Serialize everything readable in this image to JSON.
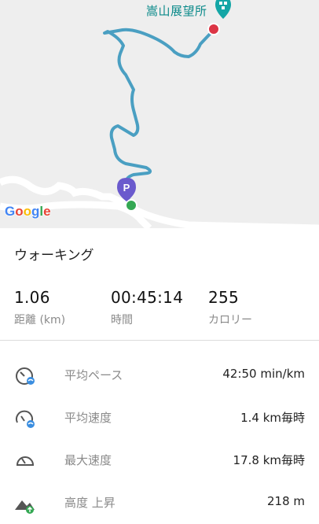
{
  "map": {
    "poi_label": "嵩山展望所",
    "poi_icon": "poi-marker-icon",
    "parking_icon": "parking-marker-icon",
    "parking_letter": "P",
    "google_logo": [
      "G",
      "o",
      "o",
      "g",
      "l",
      "e"
    ],
    "google_colors": [
      "#4285F4",
      "#EA4335",
      "#FBBC05",
      "#4285F4",
      "#34A853",
      "#EA4335"
    ],
    "route_color": "#4a9fc2",
    "start_color": "#34a853",
    "end_color": "#dc3545"
  },
  "summary": {
    "activity": "ウォーキング",
    "stats": [
      {
        "value": "1.06",
        "label": "距離 (km)"
      },
      {
        "value": "00:45:14",
        "label": "時間"
      },
      {
        "value": "255",
        "label": "カロリー"
      }
    ]
  },
  "metrics": [
    {
      "icon": "pace-gauge-icon",
      "name": "平均ペース",
      "value": "42:50 min/km"
    },
    {
      "icon": "avg-speed-gauge-icon",
      "name": "平均速度",
      "value": "1.4 km毎時"
    },
    {
      "icon": "max-speed-gauge-icon",
      "name": "最大速度",
      "value": "17.8 km毎時"
    },
    {
      "icon": "elevation-gain-icon",
      "name": "高度 上昇",
      "value": "218 m"
    }
  ]
}
